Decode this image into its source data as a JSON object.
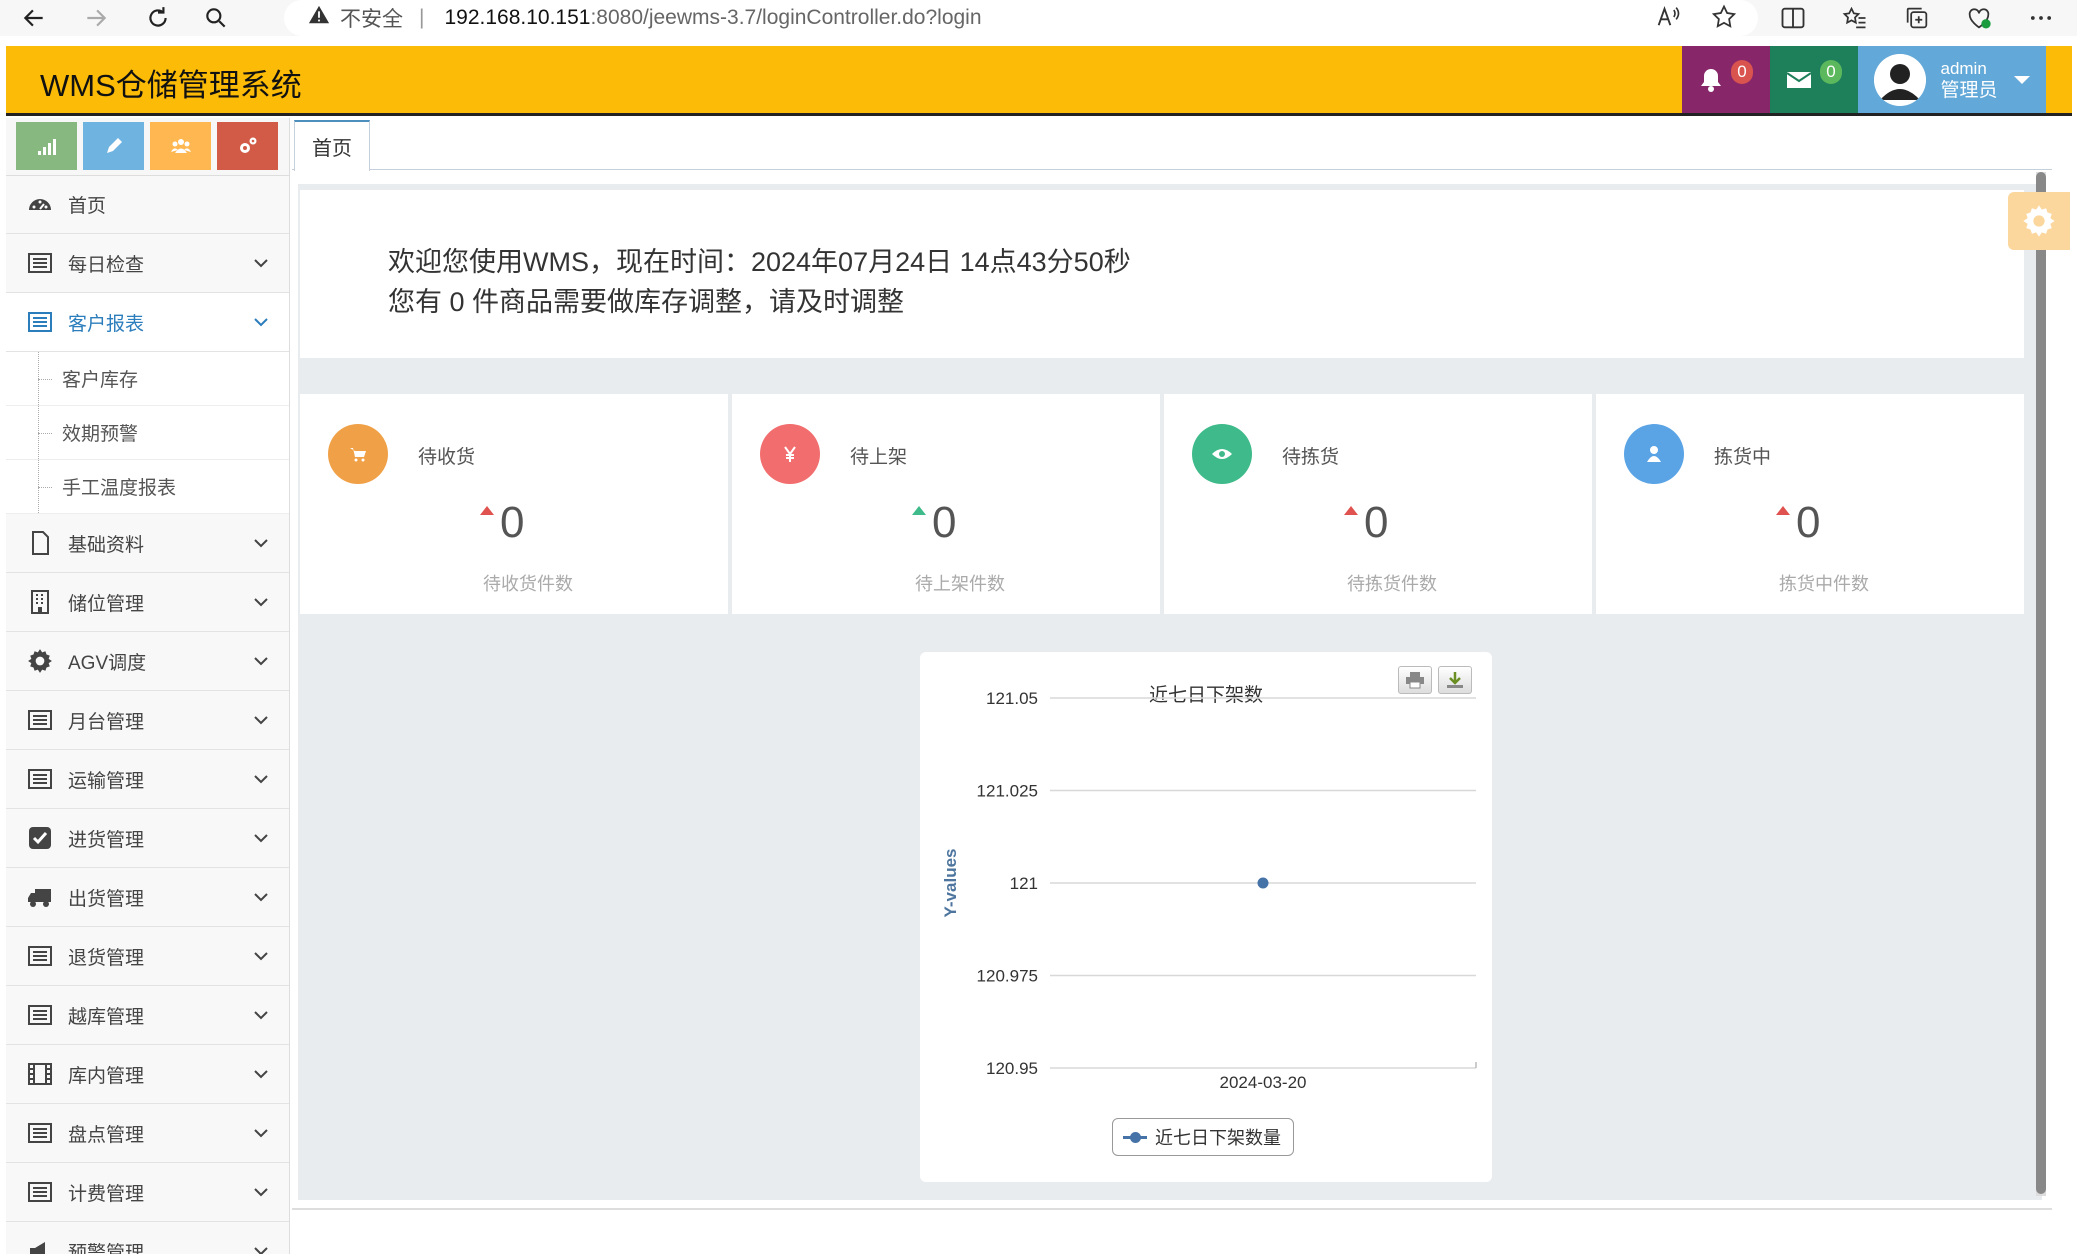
{
  "browser": {
    "insecure_label": "不安全",
    "separator": "|",
    "url_host": "192.168.10.151",
    "url_path": ":8080/jeewms-3.7/loginController.do?login"
  },
  "header": {
    "app_title": "WMS仓储管理系统",
    "bell_count": "0",
    "mail_count": "0",
    "user_name": "admin",
    "user_role": "管理员"
  },
  "sidebar": {
    "items": [
      {
        "label": "首页",
        "icon": "dashboard-icon"
      },
      {
        "label": "每日检查",
        "icon": "list-icon"
      },
      {
        "label": "客户报表",
        "icon": "list-icon",
        "expanded": true
      },
      {
        "label": "基础资料",
        "icon": "file-icon"
      },
      {
        "label": "储位管理",
        "icon": "building-icon"
      },
      {
        "label": "AGV调度",
        "icon": "gear-icon"
      },
      {
        "label": "月台管理",
        "icon": "list-icon"
      },
      {
        "label": "运输管理",
        "icon": "list-icon"
      },
      {
        "label": "进货管理",
        "icon": "check-square-icon"
      },
      {
        "label": "出货管理",
        "icon": "truck-icon"
      },
      {
        "label": "退货管理",
        "icon": "list-icon"
      },
      {
        "label": "越库管理",
        "icon": "list-icon"
      },
      {
        "label": "库内管理",
        "icon": "film-icon"
      },
      {
        "label": "盘点管理",
        "icon": "list-icon"
      },
      {
        "label": "计费管理",
        "icon": "list-icon"
      },
      {
        "label": "预警管理",
        "icon": "bullhorn-icon"
      }
    ],
    "subitems": [
      "客户库存",
      "效期预警",
      "手工温度报表"
    ]
  },
  "tabs": [
    {
      "label": "首页"
    }
  ],
  "welcome": {
    "line1": "欢迎您使用WMS，现在时间：2024年07月24日 14点43分50秒",
    "line2": "您有 0 件商品需要做库存调整，请及时调整"
  },
  "stats": [
    {
      "label": "待收货",
      "value": "0",
      "sub": "待收货件数",
      "color": "#f0a148",
      "icon": "cart-icon",
      "trend": "up-red"
    },
    {
      "label": "待上架",
      "value": "0",
      "sub": "待上架件数",
      "color": "#f26d6d",
      "icon": "yen-icon",
      "trend": "up-green"
    },
    {
      "label": "待拣货",
      "value": "0",
      "sub": "待拣货件数",
      "color": "#3fba8a",
      "icon": "eye-icon",
      "trend": "up-red"
    },
    {
      "label": "拣货中",
      "value": "0",
      "sub": "拣货中件数",
      "color": "#5aa4e6",
      "icon": "user-icon",
      "trend": "up-red"
    }
  ],
  "chart_data": {
    "type": "line",
    "title": "近七日下架数",
    "ylabel": "Y-values",
    "xlabel": "",
    "x": [
      "2024-03-20"
    ],
    "series": [
      {
        "name": "近七日下架数量",
        "values": [
          121
        ]
      }
    ],
    "ylim": [
      120.95,
      121.05
    ],
    "yticks": [
      "121.05",
      "121.025",
      "121",
      "120.975",
      "120.95"
    ],
    "grid": true,
    "legend": "bottom",
    "color": "#4572a7"
  }
}
